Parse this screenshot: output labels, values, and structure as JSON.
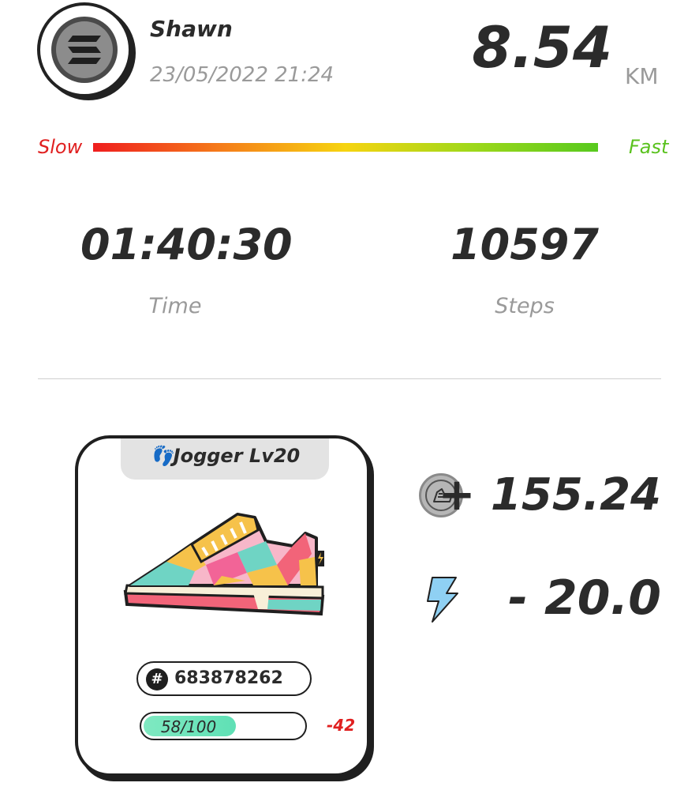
{
  "header": {
    "username": "Shawn",
    "datetime": "23/05/2022 21:24",
    "distance": "8.54",
    "distance_unit": "KM",
    "avatar_icon": "solana-logo-icon"
  },
  "speed": {
    "slow_label": "Slow",
    "fast_label": "Fast",
    "colors": [
      "#ef1e1e",
      "#f6d410",
      "#57c91e"
    ]
  },
  "stats": {
    "time_value": "01:40:30",
    "time_label": "Time",
    "steps_value": "10597",
    "steps_label": "Steps"
  },
  "sneaker": {
    "type_label": "👣Jogger Lv20",
    "id_hash": "#",
    "id": "683878262",
    "durability_text": "58/100",
    "durability_fraction": 0.58,
    "durability_delta": "-42",
    "image_icon": "sneaker-icon"
  },
  "rewards": {
    "earned": "+ 155.24",
    "earned_icon": "gst-coin-icon",
    "energy": "- 20.0",
    "energy_icon": "lightning-bolt-icon"
  }
}
